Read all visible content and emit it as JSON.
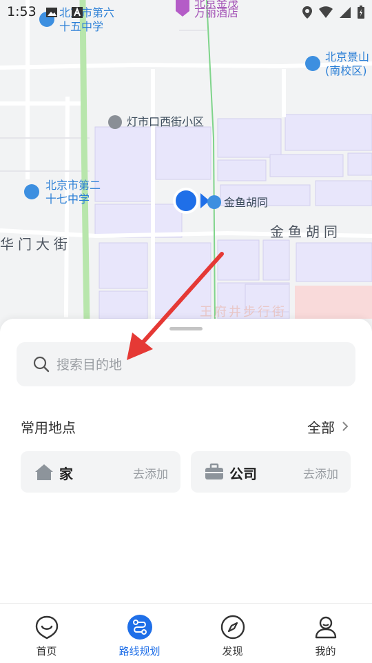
{
  "status_bar": {
    "time": "1:53"
  },
  "map_labels": {
    "school_65_line1": "北京市第六",
    "school_65_line2": "十五中学",
    "hotel_line1": "北京金茂",
    "hotel_line2": "万丽酒店",
    "jingshan_line1": "北京景山",
    "jingshan_line2": "(南校区)",
    "dengshikou": "灯市口西街小区",
    "school_27_line1": "北京市第二",
    "school_27_line2": "十七中学",
    "jinyu_poi": "金鱼胡同",
    "jinyu_road": "金鱼胡同",
    "huamen_road": "华门大街",
    "wangfujing": "王府井步行街"
  },
  "search": {
    "placeholder": "搜索目的地",
    "value": ""
  },
  "favorites": {
    "title": "常用地点",
    "all_label": "全部",
    "items": [
      {
        "name": "家",
        "action": "去添加",
        "icon": "home-icon"
      },
      {
        "name": "公司",
        "action": "去添加",
        "icon": "briefcase-icon"
      }
    ]
  },
  "bottom_nav": {
    "active": "路线规划",
    "items": [
      {
        "label": "首页",
        "icon": "home-smile-icon"
      },
      {
        "label": "路线规划",
        "icon": "route-icon"
      },
      {
        "label": "发现",
        "icon": "compass-icon"
      },
      {
        "label": "我的",
        "icon": "profile-icon"
      }
    ]
  },
  "colors": {
    "accent": "#1f6fe8",
    "annotation_arrow": "#e53935",
    "building": "#e8e6fb"
  }
}
